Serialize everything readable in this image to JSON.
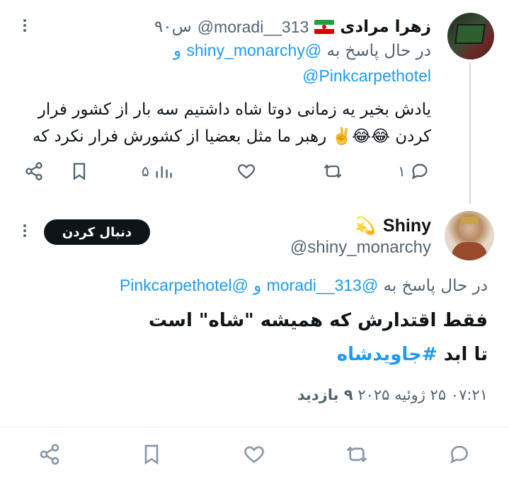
{
  "reply_tweet": {
    "display_name": "زهرا مرادی",
    "handle": "@moradi__313",
    "time": "۹۰س",
    "replying_prefix": "در حال پاسخ به",
    "replying_to_1": "@shiny_monarchy",
    "replying_and": "و",
    "replying_to_2": "@Pinkcarpethotel",
    "text_line1": "یادش بخیر یه زمانی دوتا شاه داشتیم سه بار از کشور فرار",
    "text_line2": "کردن 😂😂✌️ رهبر ما مثل بعضیا از کشورش فرار نکرد که",
    "replies_count": "۱",
    "views_count": "۵"
  },
  "main_tweet": {
    "display_name": "Shiny",
    "name_emoji": "💫",
    "handle": "@shiny_monarchy",
    "follow_label": "دنبال کردن",
    "replying_prefix": "در حال پاسخ به",
    "replying_to_1": "@moradi__313",
    "replying_and": "و",
    "replying_to_2": "@Pinkcarpethotel",
    "text_line1": "فقط اقتدارش که همیشه \"شاه\" است",
    "text_line2_prefix": "تا ابد",
    "hashtag": "#جاویدشاه",
    "timestamp": "۰۷:۲۱ ۲۵ ژوئیه ۲۰۲۵",
    "views_label": "۹ بازدید"
  },
  "colors": {
    "link": "#1d9bf0",
    "text": "#0f1419",
    "muted": "#536471"
  },
  "icons": [
    "share-icon",
    "bookmark-icon",
    "views-icon",
    "like-icon",
    "retweet-icon",
    "reply-icon",
    "more-icon"
  ]
}
